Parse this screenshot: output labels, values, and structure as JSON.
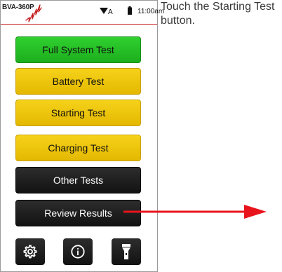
{
  "status_bar": {
    "model": "BVA-360P",
    "network": "A",
    "time": "11:00am",
    "accent_color": "#c41a1a"
  },
  "menu": {
    "buttons": [
      {
        "label": "Full System Test",
        "style": "green"
      },
      {
        "label": "Battery Test",
        "style": "yellow"
      },
      {
        "label": "Starting Test",
        "style": "yellow"
      },
      {
        "label": "Charging Test",
        "style": "yellow"
      },
      {
        "label": "Other Tests",
        "style": "dark"
      },
      {
        "label": "Review Results",
        "style": "dark"
      }
    ]
  },
  "bottom_bar": {
    "icons": [
      "gear-icon",
      "info-icon",
      "flashlight-icon"
    ]
  },
  "instruction": {
    "text": "Touch the Starting Test button."
  },
  "colors": {
    "green": "#1dae1d",
    "yellow": "#e4b800",
    "dark": "#1a1a1a",
    "arrow": "#e8141c"
  }
}
